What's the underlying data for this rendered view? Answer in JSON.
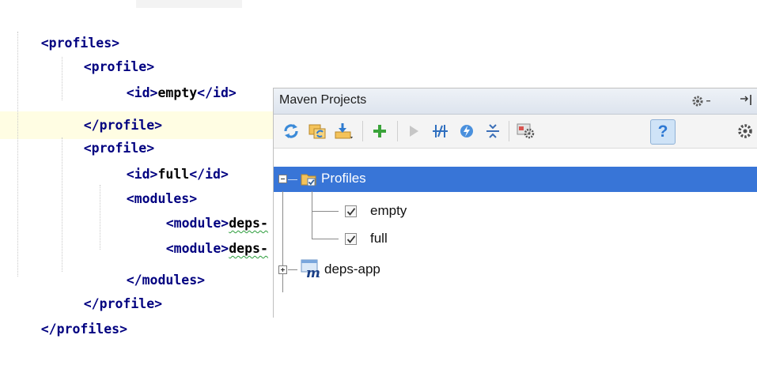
{
  "editor": {
    "lines": [
      {
        "open": "<profiles>"
      },
      {
        "open": "<profile>"
      },
      {
        "open": "<id>",
        "text": "empty",
        "close": "</id>"
      },
      {
        "open": "</profile>"
      },
      {
        "open": "<profile>"
      },
      {
        "open": "<id>",
        "text": "full",
        "close": "</id>"
      },
      {
        "open": "<modules>"
      },
      {
        "open": "<module>",
        "text": "deps-"
      },
      {
        "open": "<module>",
        "text": "deps-"
      },
      {
        "open": "</modules>"
      },
      {
        "open": "</profile>"
      },
      {
        "open": "</profiles>"
      }
    ]
  },
  "maven_panel": {
    "title": "Maven Projects",
    "toolbar": {
      "icons": [
        "refresh-icon",
        "generate-sources-icon",
        "download-icon",
        "add-icon",
        "run-icon",
        "skip-tests-icon",
        "lifecycle-icon",
        "collapse-all-icon",
        "settings-icon",
        "help-icon"
      ],
      "help_label": "?"
    },
    "header_icons": [
      "gear-icon",
      "hide-icon"
    ],
    "tree": {
      "profiles_label": "Profiles",
      "profiles": [
        {
          "label": "empty",
          "checked": true
        },
        {
          "label": "full",
          "checked": true
        }
      ],
      "project_label": "deps-app"
    }
  },
  "colors": {
    "selection": "#3875d7",
    "tag": "#000080",
    "highlight_line": "#fffde3"
  }
}
